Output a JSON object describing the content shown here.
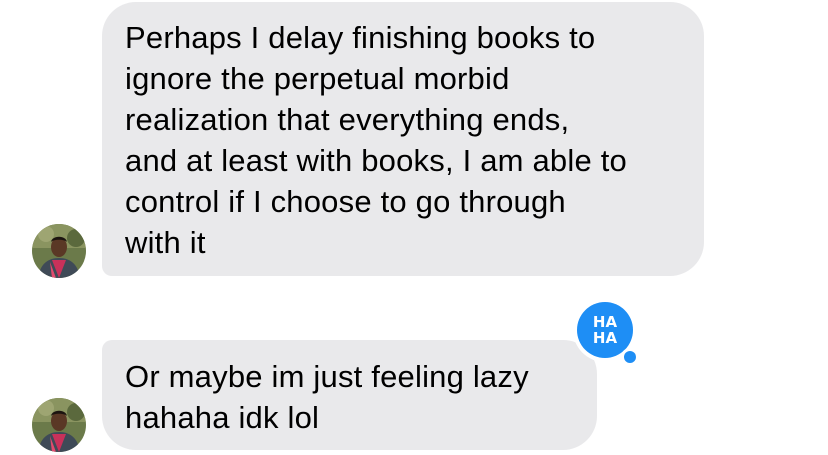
{
  "conversation": {
    "messages": [
      {
        "sender": "other",
        "lines": [
          "Perhaps I delay finishing books to",
          "ignore the perpetual morbid",
          "realization that everything ends,",
          "and at least with books, I am able to",
          "control if I choose to go through",
          "with it"
        ]
      },
      {
        "sender": "other",
        "lines": [
          "Or maybe im just feeling lazy",
          "hahaha idk lol"
        ],
        "reaction": {
          "icon": "haha-reaction-icon",
          "line1": "HA",
          "line2": "HA",
          "color": "#1e8ef5"
        }
      }
    ]
  },
  "colors": {
    "bubble_bg": "#e9e9eb",
    "text": "#000000",
    "reaction_blue": "#1e8ef5"
  }
}
